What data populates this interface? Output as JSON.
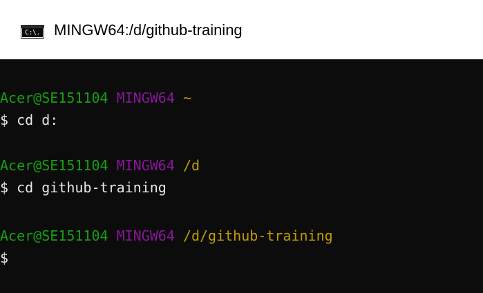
{
  "window": {
    "title": "MINGW64:/d/github-training",
    "icon_label": "C:\\."
  },
  "terminal": {
    "blocks": [
      {
        "prompt": {
          "user": "Acer@SE151104",
          "system": "MINGW64",
          "path": "~"
        },
        "command": "$ cd d:"
      },
      {
        "prompt": {
          "user": "Acer@SE151104",
          "system": "MINGW64",
          "path": "/d"
        },
        "command": "$ cd github-training"
      },
      {
        "prompt": {
          "user": "Acer@SE151104",
          "system": "MINGW64",
          "path": "/d/github-training"
        },
        "command": "$"
      }
    ]
  },
  "colors": {
    "background": "#0c0c0c",
    "user": "#13a10e",
    "system": "#881798",
    "path": "#c19c00",
    "text": "#e6e6e6"
  }
}
